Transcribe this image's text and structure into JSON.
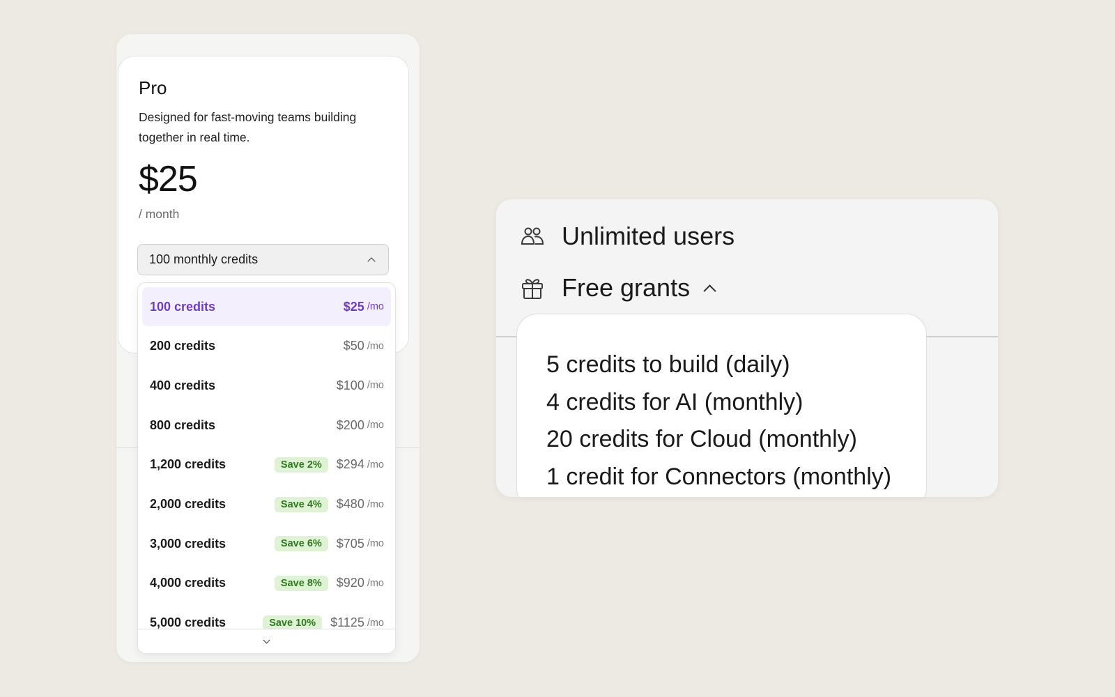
{
  "plan": {
    "name": "Pro",
    "description": "Designed for fast-moving teams building together in real time.",
    "price": "$25",
    "period": "/ month"
  },
  "credits_select": {
    "value": "100 monthly credits",
    "options": [
      {
        "label": "100 credits",
        "price": "$25",
        "unit": "/mo",
        "save": "",
        "selected": true
      },
      {
        "label": "200 credits",
        "price": "$50",
        "unit": "/mo",
        "save": ""
      },
      {
        "label": "400 credits",
        "price": "$100",
        "unit": "/mo",
        "save": ""
      },
      {
        "label": "800 credits",
        "price": "$200",
        "unit": "/mo",
        "save": ""
      },
      {
        "label": "1,200 credits",
        "price": "$294",
        "unit": "/mo",
        "save": "Save 2%"
      },
      {
        "label": "2,000 credits",
        "price": "$480",
        "unit": "/mo",
        "save": "Save 4%"
      },
      {
        "label": "3,000 credits",
        "price": "$705",
        "unit": "/mo",
        "save": "Save 6%"
      },
      {
        "label": "4,000 credits",
        "price": "$920",
        "unit": "/mo",
        "save": "Save 8%"
      },
      {
        "label": "5,000 credits",
        "price": "$1125",
        "unit": "/mo",
        "save": "Save 10%"
      }
    ]
  },
  "features": {
    "users": {
      "label": "Unlimited users",
      "icon": "users-icon"
    },
    "grants": {
      "label": "Free grants",
      "icon": "gift-icon",
      "items": [
        "5 credits to build (daily)",
        "4 credits for AI (monthly)",
        "20 credits for Cloud (monthly)",
        "1 credit for Connectors (monthly)"
      ]
    }
  },
  "colors": {
    "background": "#edeae3",
    "accent": "#6f3fb8",
    "selected_bg": "#f3effd",
    "save_badge_bg": "#dff2d5",
    "save_badge_text": "#2f7a1e"
  }
}
